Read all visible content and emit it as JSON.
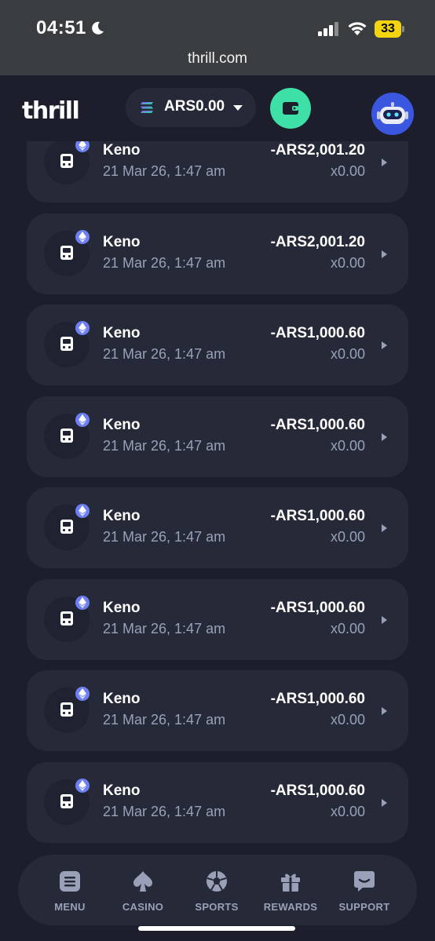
{
  "status_bar": {
    "time": "04:51",
    "battery": "33"
  },
  "browser": {
    "url": "thrill.com"
  },
  "header": {
    "logo": "thrill",
    "balance": "ARS0.00"
  },
  "colors": {
    "background": "#1c1f2b",
    "card": "#262a38",
    "accent_green": "#3ee0a8",
    "muted_text": "#9aa0b8",
    "eth_badge": "#6d7ff2"
  },
  "transactions": [
    {
      "game": "Keno",
      "date": "21 Mar 26, 1:47 am",
      "amount": "-ARS2,001.20",
      "multiplier": "x0.00"
    },
    {
      "game": "Keno",
      "date": "21 Mar 26, 1:47 am",
      "amount": "-ARS2,001.20",
      "multiplier": "x0.00"
    },
    {
      "game": "Keno",
      "date": "21 Mar 26, 1:47 am",
      "amount": "-ARS1,000.60",
      "multiplier": "x0.00"
    },
    {
      "game": "Keno",
      "date": "21 Mar 26, 1:47 am",
      "amount": "-ARS1,000.60",
      "multiplier": "x0.00"
    },
    {
      "game": "Keno",
      "date": "21 Mar 26, 1:47 am",
      "amount": "-ARS1,000.60",
      "multiplier": "x0.00"
    },
    {
      "game": "Keno",
      "date": "21 Mar 26, 1:47 am",
      "amount": "-ARS1,000.60",
      "multiplier": "x0.00"
    },
    {
      "game": "Keno",
      "date": "21 Mar 26, 1:47 am",
      "amount": "-ARS1,000.60",
      "multiplier": "x0.00"
    },
    {
      "game": "Keno",
      "date": "21 Mar 26, 1:47 am",
      "amount": "-ARS1,000.60",
      "multiplier": "x0.00"
    }
  ],
  "bottom_nav": [
    {
      "label": "MENU",
      "icon": "menu-icon"
    },
    {
      "label": "CASINO",
      "icon": "spade-icon"
    },
    {
      "label": "SPORTS",
      "icon": "soccer-ball-icon"
    },
    {
      "label": "REWARDS",
      "icon": "gift-icon"
    },
    {
      "label": "SUPPORT",
      "icon": "chat-icon"
    }
  ]
}
